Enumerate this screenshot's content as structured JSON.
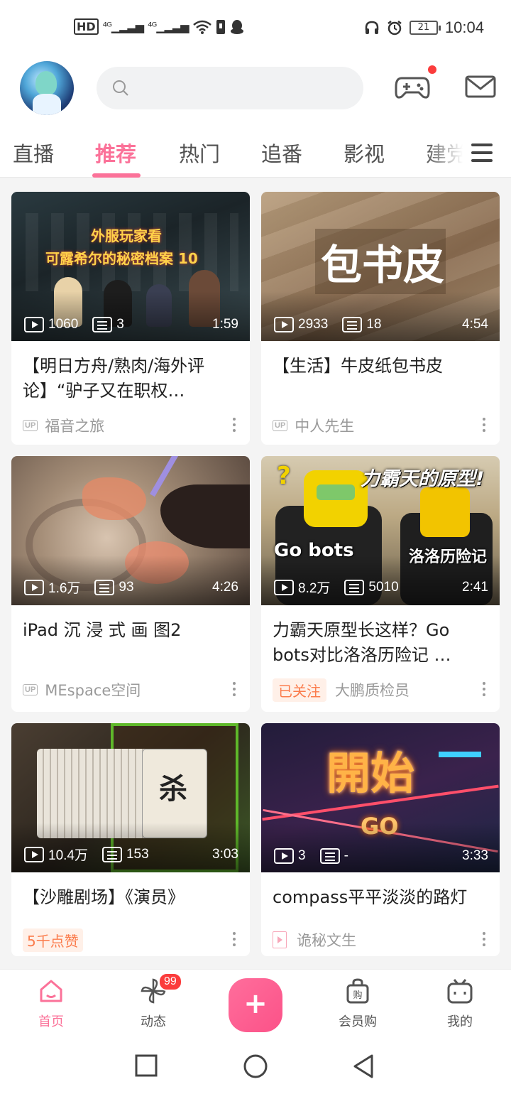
{
  "status_bar": {
    "left_icons": [
      "hd-icon",
      "signal-4g-icon",
      "signal-4g-icon",
      "wifi-icon",
      "sim-icon",
      "qq-icon"
    ],
    "battery": "21",
    "time": "10:04"
  },
  "header": {
    "search_placeholder": "",
    "game_has_notification": true
  },
  "tabs": [
    {
      "label": "直播",
      "active": false
    },
    {
      "label": "推荐",
      "active": true
    },
    {
      "label": "热门",
      "active": false
    },
    {
      "label": "追番",
      "active": false
    },
    {
      "label": "影视",
      "active": false
    },
    {
      "label": "建党",
      "active": false
    }
  ],
  "videos": [
    {
      "thumb_text_1": "外服玩家看",
      "thumb_text_2": "可露希尔的秘密档案 10",
      "plays": "1060",
      "danmaku": "3",
      "duration": "1:59",
      "title": "【明日方舟/熟肉/海外评论】“驴子又在职权…",
      "badge": "UP",
      "author": "福音之旅"
    },
    {
      "thumb_text_1": "包书皮",
      "plays": "2933",
      "danmaku": "18",
      "duration": "4:54",
      "title": "【生活】牛皮纸包书皮",
      "badge": "UP",
      "author": "中人先生"
    },
    {
      "plays": "1.6万",
      "danmaku": "93",
      "duration": "4:26",
      "title": "iPad 沉 浸 式 画 图2",
      "badge": "UP",
      "author": "MEspace空间"
    },
    {
      "thumb_text_1": "力霸天的原型!",
      "thumb_text_2": "Go  bots",
      "thumb_text_3": "洛洛历险记",
      "plays": "8.2万",
      "danmaku": "5010",
      "duration": "2:41",
      "title": "力霸天原型长这样？Go bots对比洛洛历险记 …",
      "followed": "已关注",
      "author": "大鹏质检员"
    },
    {
      "thumb_text_1": "杀",
      "plays": "10.4万",
      "danmaku": "153",
      "duration": "3:03",
      "title": "【沙雕剧场】《演员》",
      "likes": "5千点赞"
    },
    {
      "thumb_text_1": "開始",
      "thumb_text_2": "GO",
      "plays": "3",
      "danmaku": "-",
      "duration": "3:33",
      "title": "compass平平淡淡的路灯",
      "author": "诡秘文生"
    }
  ],
  "bottom_nav": [
    {
      "label": "首页",
      "icon": "home-tv-icon",
      "active": true
    },
    {
      "label": "动态",
      "icon": "pinwheel-icon",
      "badge": "99"
    },
    {
      "label": "+",
      "icon": "plus-icon"
    },
    {
      "label": "会员购",
      "icon": "shopping-bag-icon"
    },
    {
      "label": "我的",
      "icon": "tv-face-icon"
    }
  ],
  "colors": {
    "accent": "#fb7299",
    "badge_red": "#fb3c3c",
    "tag_orange": "#fb7c4c"
  }
}
